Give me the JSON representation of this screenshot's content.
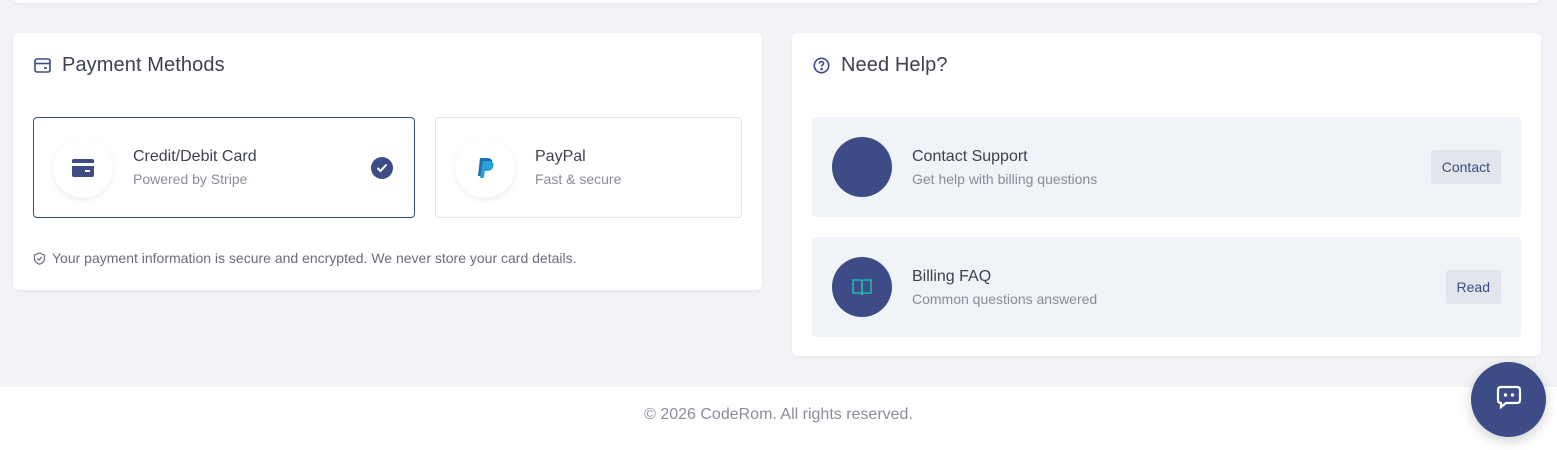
{
  "payment": {
    "title": "Payment Methods",
    "methods": [
      {
        "name": "Credit/Debit Card",
        "sub": "Powered by Stripe",
        "selected": true,
        "icon": "credit-card-icon"
      },
      {
        "name": "PayPal",
        "sub": "Fast & secure",
        "selected": false,
        "icon": "paypal-icon"
      }
    ],
    "secure_note": "Your payment information is secure and encrypted. We never store your card details."
  },
  "help": {
    "title": "Need Help?",
    "items": [
      {
        "title": "Contact Support",
        "sub": "Get help with billing questions",
        "button": "Contact",
        "icon": "support-icon"
      },
      {
        "title": "Billing FAQ",
        "sub": "Common questions answered",
        "button": "Read",
        "icon": "book-icon"
      }
    ]
  },
  "footer": {
    "copyright": "© 2026 CodeRom. All rights reserved."
  },
  "colors": {
    "accent": "#3d4b86",
    "paypal_blue": "#2a9fd8",
    "faq_icon": "#1fb5a6",
    "background": "#f2f2f7"
  }
}
